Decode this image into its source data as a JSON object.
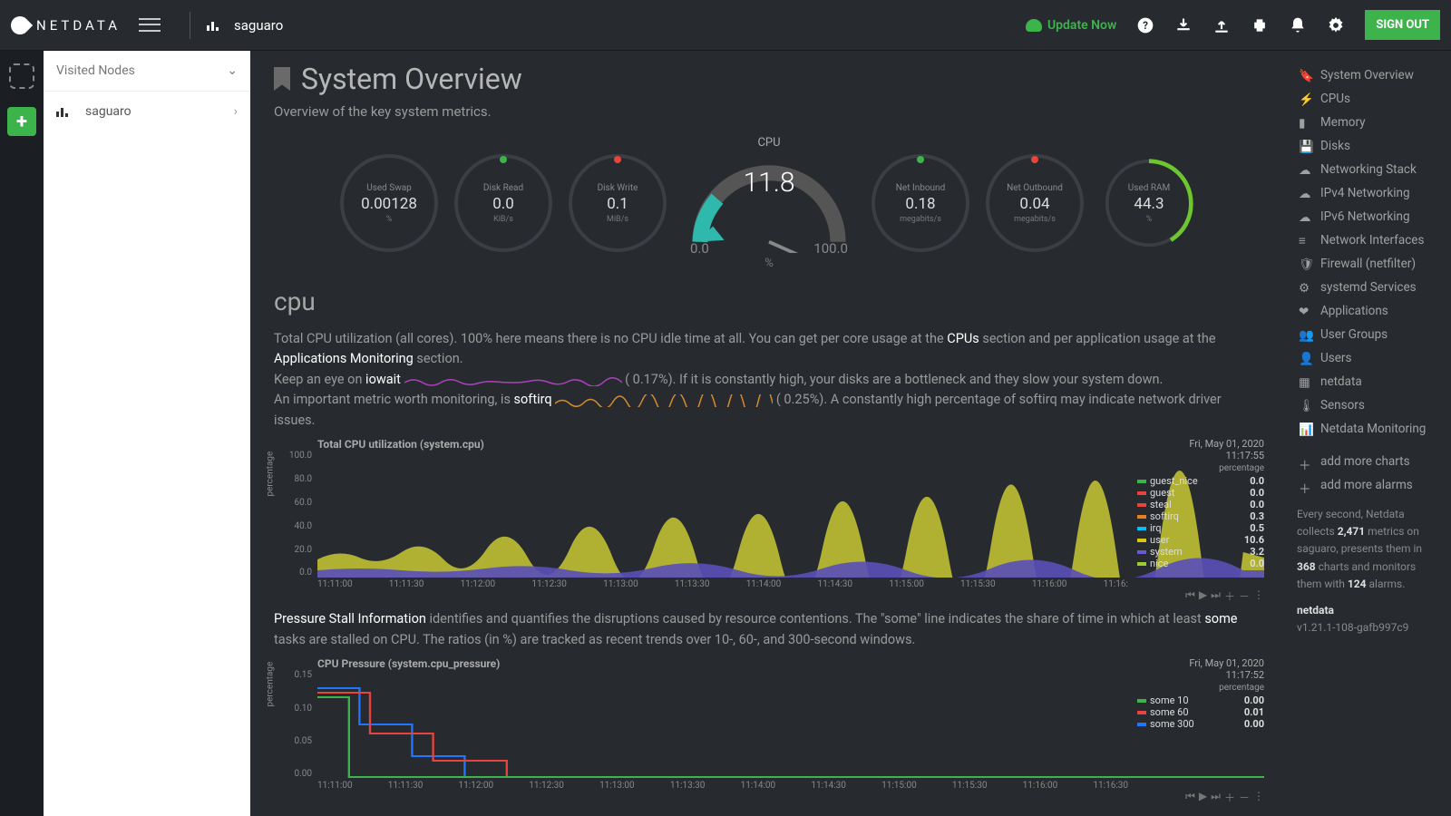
{
  "brand": "NETDATA",
  "node": "saguaro",
  "topbar": {
    "update": "Update Now",
    "signout": "SIGN OUT"
  },
  "sidebar": {
    "visited": "Visited Nodes",
    "node": "saguaro"
  },
  "page": {
    "title": "System Overview",
    "subtitle": "Overview of the key system metrics."
  },
  "gauges": {
    "swap": {
      "label": "Used Swap",
      "value": "0.00128",
      "unit": "%",
      "dot": ""
    },
    "diskr": {
      "label": "Disk Read",
      "value": "0.0",
      "unit": "KiB/s",
      "dot": "#3cb44b"
    },
    "diskw": {
      "label": "Disk Write",
      "value": "0.1",
      "unit": "MiB/s",
      "dot": "#e6443c"
    },
    "cpu": {
      "label": "CPU",
      "value": "11.8",
      "min": "0.0",
      "max": "100.0",
      "pct": "%"
    },
    "neti": {
      "label": "Net Inbound",
      "value": "0.18",
      "unit": "megabits/s",
      "dot": "#3cb44b"
    },
    "neto": {
      "label": "Net Outbound",
      "value": "0.04",
      "unit": "megabits/s",
      "dot": "#e6443c"
    },
    "ram": {
      "label": "Used RAM",
      "value": "44.3",
      "unit": "%"
    }
  },
  "cpu_section": {
    "title": "cpu",
    "p1a": "Total CPU utilization (all cores). 100% here means there is no CPU idle time at all. You can get per core usage at the ",
    "p1b": "CPUs",
    "p1c": " section and per application usage at the ",
    "p1d": "Applications Monitoring",
    "p1e": " section.",
    "p2a": "Keep an eye on ",
    "p2b": "iowait",
    "p2c": " (       0.17%). If it is constantly high, your disks are a bottleneck and they slow your system down.",
    "p3a": "An important metric worth monitoring, is ",
    "p3b": "softirq",
    "p3c": " (       0.25%). A constantly high percentage of softirq may indicate network driver issues."
  },
  "chart_data": [
    {
      "type": "area",
      "title": "Total CPU utilization (system.cpu)",
      "ylabel": "percentage",
      "ylim": [
        0,
        100
      ],
      "yticks": [
        "100.0",
        "80.0",
        "60.0",
        "40.0",
        "20.0",
        "0.0"
      ],
      "xticks": [
        "11:11:00",
        "11:11:30",
        "11:12:00",
        "11:12:30",
        "11:13:00",
        "11:13:30",
        "11:14:00",
        "11:14:30",
        "11:15:00",
        "11:15:30",
        "11:16:00",
        "11:16:"
      ],
      "timestamp": {
        "date": "Fri, May 01, 2020",
        "time": "11:17:55"
      },
      "series": [
        {
          "name": "guest_nice",
          "color": "#3cb44b",
          "value": "0.0"
        },
        {
          "name": "guest",
          "color": "#e6443c",
          "value": "0.0"
        },
        {
          "name": "steal",
          "color": "#e6443c",
          "value": "0.0"
        },
        {
          "name": "softirq",
          "color": "#e67e22",
          "value": "0.3"
        },
        {
          "name": "irq",
          "color": "#00bfff",
          "value": "0.5"
        },
        {
          "name": "user",
          "color": "#d6c90f",
          "value": "10.6"
        },
        {
          "name": "system",
          "color": "#6a5acd",
          "value": "3.2"
        },
        {
          "name": "nice",
          "color": "#9acd32",
          "value": "0.0"
        }
      ]
    },
    {
      "type": "line",
      "title": "CPU Pressure (system.cpu_pressure)",
      "ylabel": "percentage",
      "ylim": [
        0,
        0.15
      ],
      "yticks": [
        "0.15",
        "0.10",
        "0.05",
        "0.00"
      ],
      "xticks": [
        "11:11:00",
        "11:11:30",
        "11:12:00",
        "11:12:30",
        "11:13:00",
        "11:13:30",
        "11:14:00",
        "11:14:30",
        "11:15:00",
        "11:15:30",
        "11:16:00",
        "11:16:30"
      ],
      "timestamp": {
        "date": "Fri, May 01, 2020",
        "time": "11:17:52"
      },
      "series": [
        {
          "name": "some 10",
          "color": "#3cb44b",
          "value": "0.00"
        },
        {
          "name": "some 60",
          "color": "#e6443c",
          "value": "0.01"
        },
        {
          "name": "some 300",
          "color": "#1f77ff",
          "value": "0.00"
        }
      ]
    }
  ],
  "psi": {
    "a": "Pressure Stall Information",
    "b": " identifies and quantifies the disruptions caused by resource contentions. The \"some\" line indicates the share of time in which at least ",
    "c": "some",
    "d": " tasks are stalled on CPU. The ratios (in %) are tracked as recent trends over 10-, 60-, and 300-second windows."
  },
  "rightnav": {
    "items": [
      "System Overview",
      "CPUs",
      "Memory",
      "Disks",
      "Networking Stack",
      "IPv4 Networking",
      "IPv6 Networking",
      "Network Interfaces",
      "Firewall (netfilter)",
      "systemd Services",
      "Applications",
      "User Groups",
      "Users",
      "netdata",
      "Sensors",
      "Netdata Monitoring"
    ],
    "add_charts": "add more charts",
    "add_alarms": "add more alarms",
    "info_a": "Every second, Netdata collects ",
    "info_b": "2,471",
    "info_c": " metrics on saguaro, presents them in ",
    "info_d": "368",
    "info_e": " charts and monitors them with ",
    "info_f": "124",
    "info_g": " alarms.",
    "prod": "netdata",
    "ver": "v1.21.1-108-gafb997c9"
  }
}
